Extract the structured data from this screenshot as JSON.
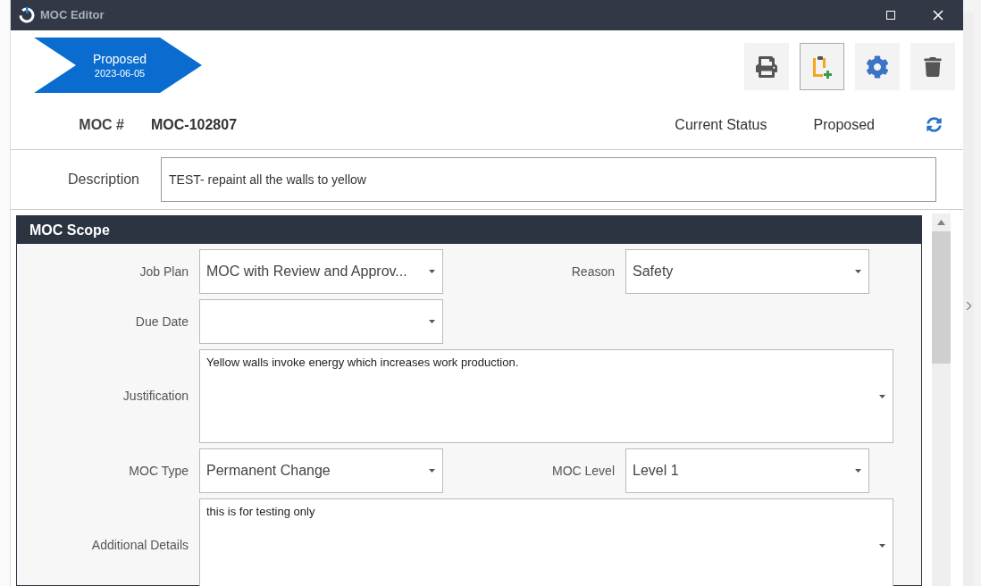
{
  "window": {
    "title": "MOC Editor"
  },
  "stage": {
    "label": "Proposed",
    "date": "2023-06-05"
  },
  "toolbar": [
    {
      "kind": "print",
      "selected": false
    },
    {
      "kind": "clipboard-add",
      "selected": true
    },
    {
      "kind": "settings",
      "selected": false
    },
    {
      "kind": "delete",
      "selected": false
    }
  ],
  "header": {
    "moc_label": "MOC #",
    "moc_value": "MOC-102807",
    "status_label": "Current Status",
    "status_value": "Proposed"
  },
  "description": {
    "label": "Description",
    "value": "TEST- repaint all the walls to yellow"
  },
  "section": {
    "title": "MOC Scope",
    "rows": [
      {
        "fields": [
          {
            "kind": "dropdown",
            "label": "Job Plan",
            "value": "MOC with Review and Approv..."
          },
          {
            "kind": "dropdown",
            "label": "Reason",
            "value": "Safety"
          }
        ]
      },
      {
        "fields": [
          {
            "kind": "dropdown",
            "label": "Due Date"
          }
        ]
      },
      {
        "fields": [
          {
            "kind": "textarea",
            "label": "Justification",
            "value": "Yellow walls invoke energy which increases work production."
          }
        ]
      },
      {
        "fields": [
          {
            "kind": "dropdown",
            "label": "MOC Type",
            "value": "Permanent Change"
          },
          {
            "kind": "dropdown",
            "label": "MOC Level",
            "value": "Level 1"
          }
        ]
      },
      {
        "fields": [
          {
            "kind": "textarea",
            "label": "Additional Details",
            "value": "this is for testing only"
          }
        ]
      }
    ]
  }
}
